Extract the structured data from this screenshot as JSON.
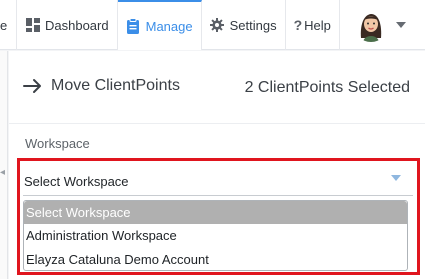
{
  "nav": {
    "partial_label": "e",
    "items": [
      {
        "label": "Dashboard",
        "icon": "dashboard-icon"
      },
      {
        "label": "Manage",
        "icon": "clipboard-icon"
      },
      {
        "label": "Settings",
        "icon": "gear-icon"
      },
      {
        "label": "Help",
        "icon": "question-icon"
      }
    ],
    "active": "Manage",
    "accent_color": "#3b8ee8"
  },
  "panel": {
    "title": "Move ClientPoints",
    "selected_count": "2 ClientPoints Selected",
    "workspace_label": "Workspace"
  },
  "workspace_select": {
    "value": "Select Workspace",
    "options": [
      "Select Workspace",
      "Administration Workspace",
      "Elayza Cataluna Demo Account"
    ],
    "highlighted_option": "Select Workspace"
  },
  "colors": {
    "highlight_border": "#e0151e",
    "selected_option_bg": "#b0b0b0"
  }
}
